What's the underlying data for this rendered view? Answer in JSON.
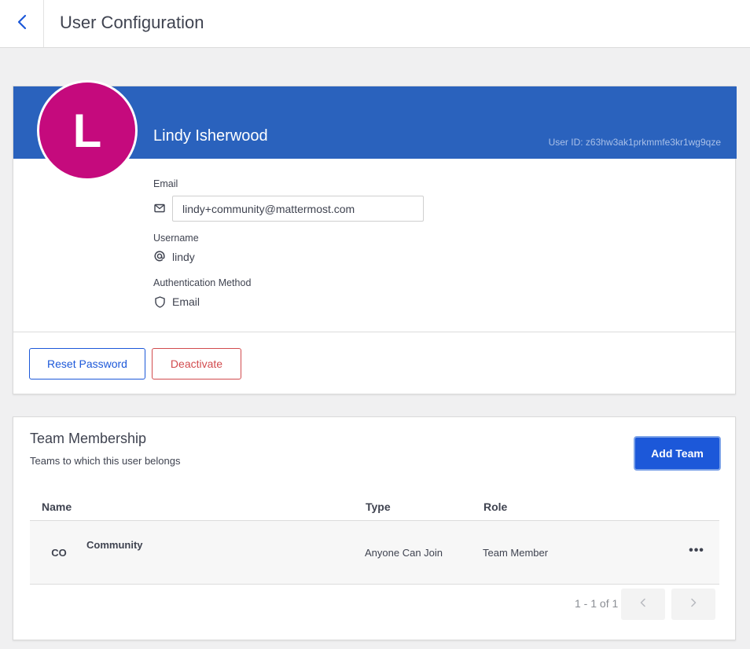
{
  "header": {
    "title": "User Configuration"
  },
  "user": {
    "avatar_initial": "L",
    "name": "Lindy Isherwood",
    "user_id": "User ID: z63hw3ak1prkmmfe3kr1wg9qze",
    "email_label": "Email",
    "email_value": "lindy+community@mattermost.com",
    "username_label": "Username",
    "username_value": "lindy",
    "auth_label": "Authentication Method",
    "auth_value": "Email",
    "reset_password_label": "Reset Password",
    "deactivate_label": "Deactivate"
  },
  "team_membership": {
    "title": "Team Membership",
    "subtitle": "Teams to which this user belongs",
    "add_team_label": "Add Team",
    "columns": [
      "Name",
      "Type",
      "Role"
    ],
    "rows": [
      {
        "initials": "CO",
        "name": "Community",
        "type": "Anyone Can Join",
        "role": "Team Member",
        "menu": "•••"
      }
    ],
    "pagination_text": "1 - 1 of 1"
  },
  "colors": {
    "banner": "#2a62bd",
    "avatar": "#c50a7d",
    "primary": "#1c58d9",
    "danger": "#d24b4e"
  },
  "icons": {
    "back": "chevron-left-icon",
    "email": "envelope-icon",
    "username": "at-sign-icon",
    "auth": "shield-icon",
    "prev_page": "chevron-left-icon",
    "next_page": "chevron-right-icon",
    "row_menu": "dots-horizontal-icon"
  }
}
